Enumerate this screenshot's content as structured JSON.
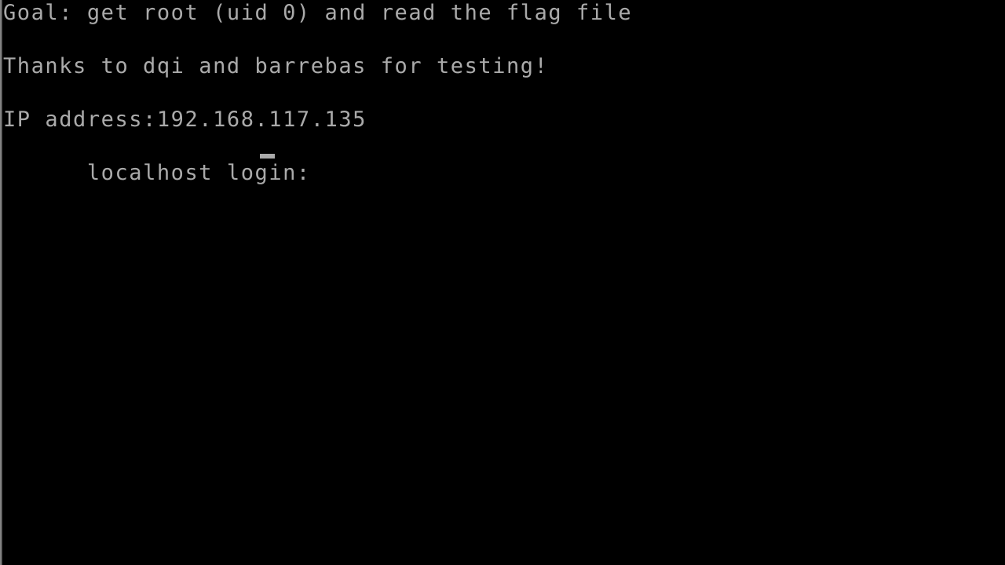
{
  "terminal": {
    "background_color": "#000000",
    "text_color": "#aaaaaa",
    "border_color": "#8c8c8c",
    "cursor_color": "#aaaaaa",
    "lines": [
      {
        "id": "goal",
        "text": "Goal: get root (uid 0) and read the flag file"
      },
      {
        "id": "blank-1",
        "text": " "
      },
      {
        "id": "thanks",
        "text": "Thanks to dqi and barrebas for testing!"
      },
      {
        "id": "blank-2",
        "text": " "
      },
      {
        "id": "ip",
        "text": "IP address:192.168.117.135"
      }
    ],
    "prompt": {
      "text": "localhost login: ",
      "hostname": "localhost",
      "label": "login:",
      "cursor": "_",
      "input_value": ""
    },
    "ip_address": "192.168.117.135",
    "goal_text": "get root (uid 0) and read the flag file",
    "credits": "Thanks to dqi and barrebas for testing!"
  }
}
